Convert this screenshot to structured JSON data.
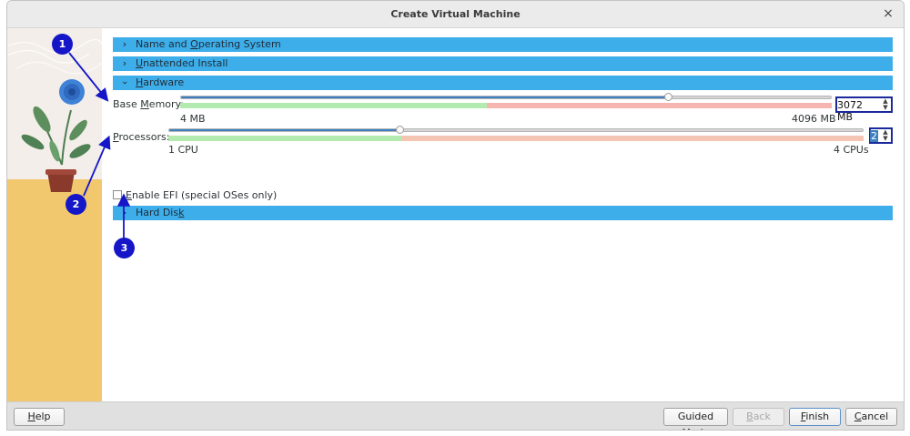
{
  "window": {
    "title": "Create Virtual Machine",
    "close_glyph": "×"
  },
  "sections": [
    {
      "prefix": "Name and ",
      "mnemonic": "O",
      "suffix": "perating System",
      "expanded": false
    },
    {
      "prefix": "",
      "mnemonic": "U",
      "suffix": "nattended Install",
      "expanded": false
    },
    {
      "prefix": "",
      "mnemonic": "H",
      "suffix": "ardware",
      "expanded": true
    },
    {
      "prefix": "Hard Dis",
      "mnemonic": "k",
      "suffix": "",
      "expanded": false
    }
  ],
  "hardware": {
    "memory": {
      "label_prefix": "Base ",
      "label_mnemonic": "M",
      "label_suffix": "emory:",
      "value": "3072 MB",
      "min_label": "4 MB",
      "max_label": "4096 MB",
      "level": 0.75
    },
    "processors": {
      "label_mnemonic": "P",
      "label_suffix": "rocessors:",
      "value": "2",
      "min_label": "1 CPU",
      "max_label": "4 CPUs",
      "level": 0.333
    },
    "efi": {
      "mnemonic": "E",
      "suffix": "nable EFI (special OSes only)",
      "checked": false
    }
  },
  "buttons": {
    "help": {
      "mnemonic": "H",
      "suffix": "elp"
    },
    "guided": {
      "prefix": "Guided Mode"
    },
    "back": {
      "mnemonic": "B",
      "suffix": "ack"
    },
    "finish": {
      "mnemonic": "F",
      "suffix": "inish"
    },
    "cancel": {
      "mnemonic": "C",
      "suffix": "ancel"
    }
  },
  "annotations": [
    "1",
    "2",
    "3"
  ],
  "colors": {
    "section_bar": "#3daee9",
    "annotation": "#1416c7",
    "slider_fill": "#3d7fc1",
    "scale_green": "#b3eab0",
    "scale_red": "#f6b5b1",
    "scale_salmon": "#f4c5b3"
  }
}
